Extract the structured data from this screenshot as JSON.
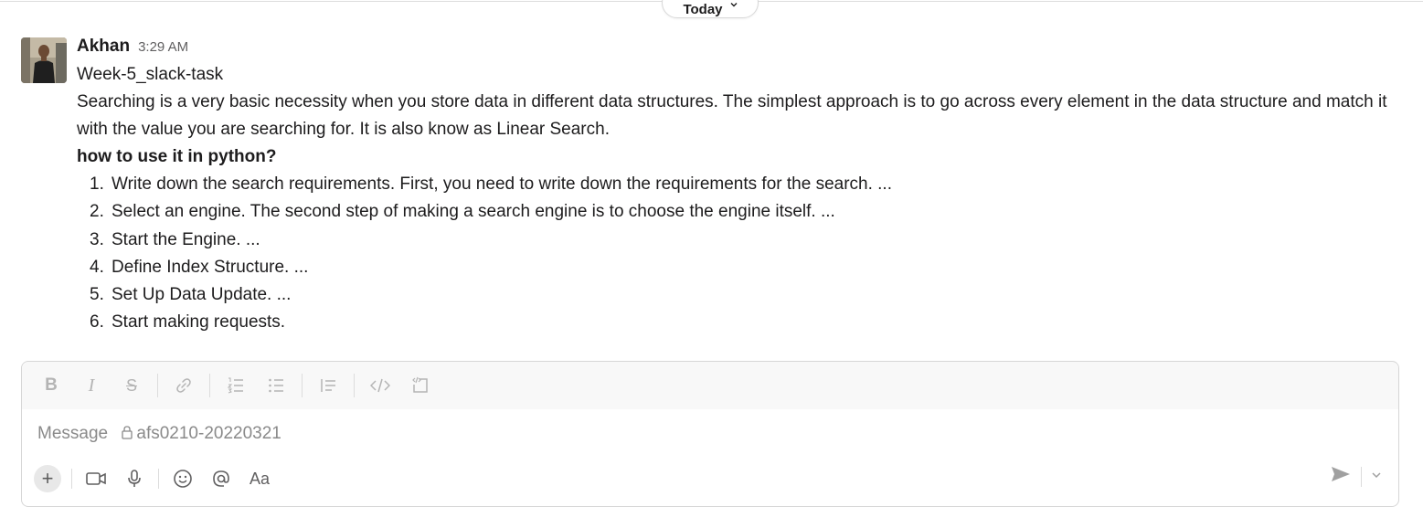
{
  "date_divider": {
    "label": "Today"
  },
  "message": {
    "sender": "Akhan",
    "time": "3:29 AM",
    "title": "Week-5_slack-task",
    "paragraph": "Searching is a very basic necessity when you store data in different data structures. The simplest approach is to go across every element in the data structure and match it with the value you are searching for. It is also know as Linear Search.",
    "subheading": "how to use it in python?",
    "steps": [
      {
        "num": "1.",
        "text": "Write down the search requirements. First, you need to write down the requirements for the search. ..."
      },
      {
        "num": "2.",
        "text": "Select an engine. The second step of making a search engine is to choose the engine itself. ..."
      },
      {
        "num": "3.",
        "text": "Start the Engine. ..."
      },
      {
        "num": "4.",
        "text": "Define Index Structure. ..."
      },
      {
        "num": "5.",
        "text": "Set Up Data Update. ..."
      },
      {
        "num": "6.",
        "text": "Start making requests."
      }
    ]
  },
  "composer": {
    "placeholder_prefix": "Message",
    "channel": "afs0210-20220321",
    "toolbar": {
      "bold": "B",
      "italic": "I",
      "strike": "S",
      "icons": [
        "link-icon",
        "ordered-list-icon",
        "bulleted-list-icon",
        "blockquote-icon",
        "code-icon",
        "code-block-icon"
      ]
    },
    "bottom": {
      "plus": "+",
      "format": "Aa",
      "icons": [
        "video-icon",
        "microphone-icon",
        "emoji-icon",
        "mention-icon",
        "format-icon",
        "send-icon",
        "send-options-chevron-icon"
      ]
    }
  },
  "colors": {
    "text": "#1d1c1d",
    "muted": "#616061",
    "toolbar_bg": "#f8f8f8",
    "border": "#d6d6d6"
  }
}
